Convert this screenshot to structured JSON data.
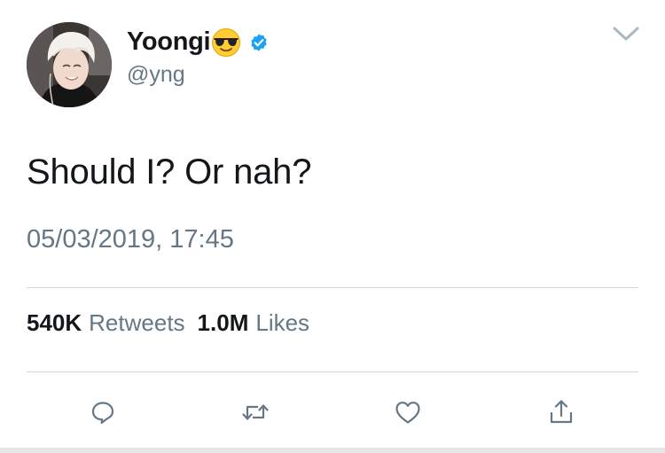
{
  "user": {
    "display_name": "Yoongi",
    "display_emoji": "smiling-face-with-sunglasses-emoji",
    "handle": "@yng",
    "verified": true,
    "avatar": "profile-photo"
  },
  "tweet": {
    "text": "Should I? Or nah?",
    "timestamp": "05/03/2019, 17:45"
  },
  "stats": {
    "retweets_count": "540K",
    "retweets_label": "Retweets",
    "likes_count": "1.0M",
    "likes_label": "Likes"
  },
  "actions": [
    {
      "icon": "reply-icon"
    },
    {
      "icon": "retweet-icon"
    },
    {
      "icon": "heart-icon"
    },
    {
      "icon": "share-icon"
    }
  ],
  "colors": {
    "primary_text": "#14171a",
    "secondary_text": "#657786",
    "verified_blue": "#1da1f2",
    "divider": "#cfd6dc",
    "icon_gray": "#657786"
  }
}
